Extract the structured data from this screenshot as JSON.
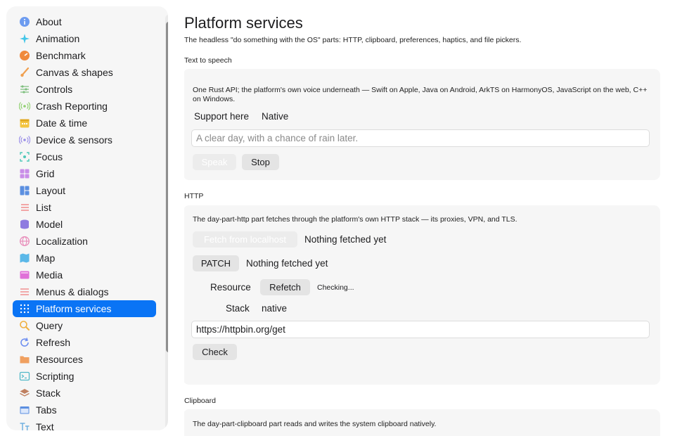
{
  "sidebar": {
    "items": [
      {
        "label": "About",
        "icon": "info-icon",
        "color": "#6d9cf0"
      },
      {
        "label": "Animation",
        "icon": "sparkles-icon",
        "color": "#43c6e8"
      },
      {
        "label": "Benchmark",
        "icon": "gauge-icon",
        "color": "#f08a3c"
      },
      {
        "label": "Canvas & shapes",
        "icon": "brush-icon",
        "color": "#f0a050"
      },
      {
        "label": "Controls",
        "icon": "sliders-icon",
        "color": "#7fbf7f"
      },
      {
        "label": "Crash Reporting",
        "icon": "broadcast-icon",
        "color": "#8fd06f"
      },
      {
        "label": "Date & time",
        "icon": "calendar-icon",
        "color": "#f4c542"
      },
      {
        "label": "Device & sensors",
        "icon": "sensor-icon",
        "color": "#9a8ee8"
      },
      {
        "label": "Focus",
        "icon": "focus-icon",
        "color": "#4fc8b8"
      },
      {
        "label": "Grid",
        "icon": "grid-icon",
        "color": "#c98de8"
      },
      {
        "label": "Layout",
        "icon": "layout-icon",
        "color": "#5b8fe0"
      },
      {
        "label": "List",
        "icon": "list-icon",
        "color": "#f08a8a"
      },
      {
        "label": "Model",
        "icon": "database-icon",
        "color": "#8e7be0"
      },
      {
        "label": "Localization",
        "icon": "globe-icon",
        "color": "#e88ab8"
      },
      {
        "label": "Map",
        "icon": "map-icon",
        "color": "#5bb8e8"
      },
      {
        "label": "Media",
        "icon": "film-icon",
        "color": "#e070d8"
      },
      {
        "label": "Menus & dialogs",
        "icon": "menu-icon",
        "color": "#f09090"
      },
      {
        "label": "Platform services",
        "icon": "dots-grid-icon",
        "color": "#ffffff"
      },
      {
        "label": "Query",
        "icon": "magnifier-icon",
        "color": "#f0b040"
      },
      {
        "label": "Refresh",
        "icon": "refresh-icon",
        "color": "#6d8ef0"
      },
      {
        "label": "Resources",
        "icon": "folder-icon",
        "color": "#f0a060"
      },
      {
        "label": "Scripting",
        "icon": "terminal-icon",
        "color": "#50b8c8"
      },
      {
        "label": "Stack",
        "icon": "stack-icon",
        "color": "#c08060"
      },
      {
        "label": "Tabs",
        "icon": "tabs-icon",
        "color": "#5b8fe0"
      },
      {
        "label": "Text",
        "icon": "text-icon",
        "color": "#70b0e0"
      }
    ],
    "selected": "Platform services",
    "accent": "#0a74f5"
  },
  "main": {
    "title": "Platform services",
    "subtitle": "The headless \"do something with the OS\" parts: HTTP, clipboard, preferences, haptics, and file pickers.",
    "tts": {
      "label": "Text to speech",
      "description": "One Rust API; the platform's own voice underneath — Swift on Apple, Java on Android, ArkTS on HarmonyOS, JavaScript on the web, C++ on Windows.",
      "support_label": "Support here",
      "support_value": "Native",
      "input_placeholder": "A clear day, with a chance of rain later.",
      "speak_label": "Speak",
      "stop_label": "Stop"
    },
    "http": {
      "label": "HTTP",
      "description": "The day-part-http part fetches through the platform's own HTTP stack — its proxies, VPN, and TLS.",
      "fetch_label": "Fetch from localhost",
      "fetch_status": "Nothing fetched yet",
      "patch_label": "PATCH",
      "patch_status": "Nothing fetched yet",
      "resource_label": "Resource",
      "refetch_label": "Refetch",
      "resource_status": "Checking...",
      "stack_label": "Stack",
      "stack_value": "native",
      "url_value": "https://httpbin.org/get",
      "check_label": "Check"
    },
    "clipboard": {
      "label": "Clipboard",
      "description": "The day-part-clipboard part reads and writes the system clipboard natively."
    }
  }
}
